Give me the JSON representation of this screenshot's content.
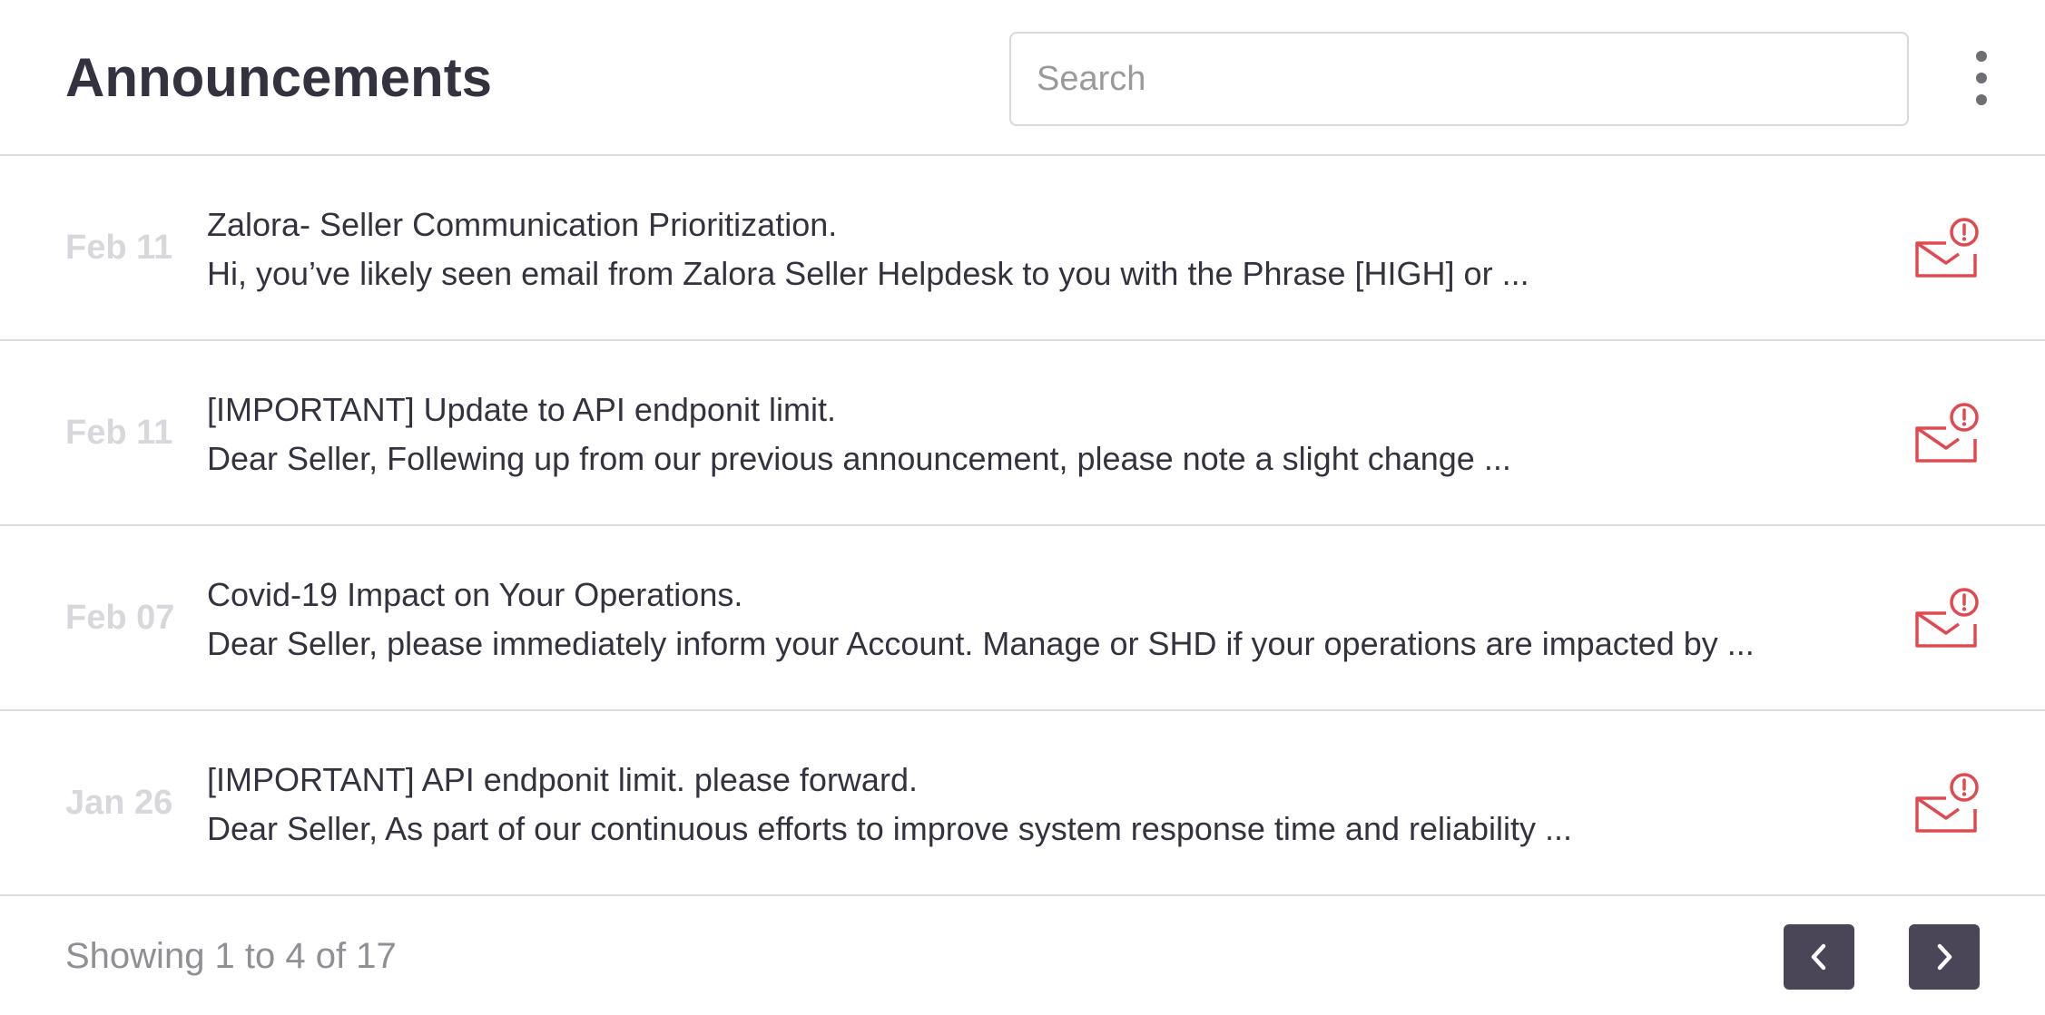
{
  "header": {
    "title": "Announcements",
    "search_placeholder": "Search",
    "search_value": ""
  },
  "announcements": [
    {
      "date": "Feb 11",
      "subject": "Zalora- Seller Communication Prioritization.",
      "preview": "Hi, you’ve likely seen email from Zalora Seller Helpdesk to you with the Phrase [HIGH] or ...",
      "icon": "mail-alert-icon"
    },
    {
      "date": "Feb 11",
      "subject": "[IMPORTANT] Update to API endponit limit.",
      "preview": "Dear Seller, Follewing up from our previous announcement, please note a slight change ...",
      "icon": "mail-alert-icon"
    },
    {
      "date": "Feb 07",
      "subject": "Covid-19 Impact on Your Operations.",
      "preview": "Dear Seller, please immediately inform your Account. Manage or SHD if your operations are impacted by ...",
      "icon": "mail-alert-icon"
    },
    {
      "date": "Jan 26",
      "subject": "[IMPORTANT] API endponit limit. please forward.",
      "preview": "Dear Seller, As part of our continuous efforts to improve system response time and reliability ...",
      "icon": "mail-alert-icon"
    }
  ],
  "footer": {
    "showing_text": "Showing 1 to 4 of 17",
    "prev_icon": "chevron-left-icon",
    "next_icon": "chevron-right-icon"
  },
  "colors": {
    "accent_red": "#e0494f",
    "pager_bg": "#4a4658",
    "text_dark": "#34323f",
    "date_muted": "#d8d8dc"
  }
}
